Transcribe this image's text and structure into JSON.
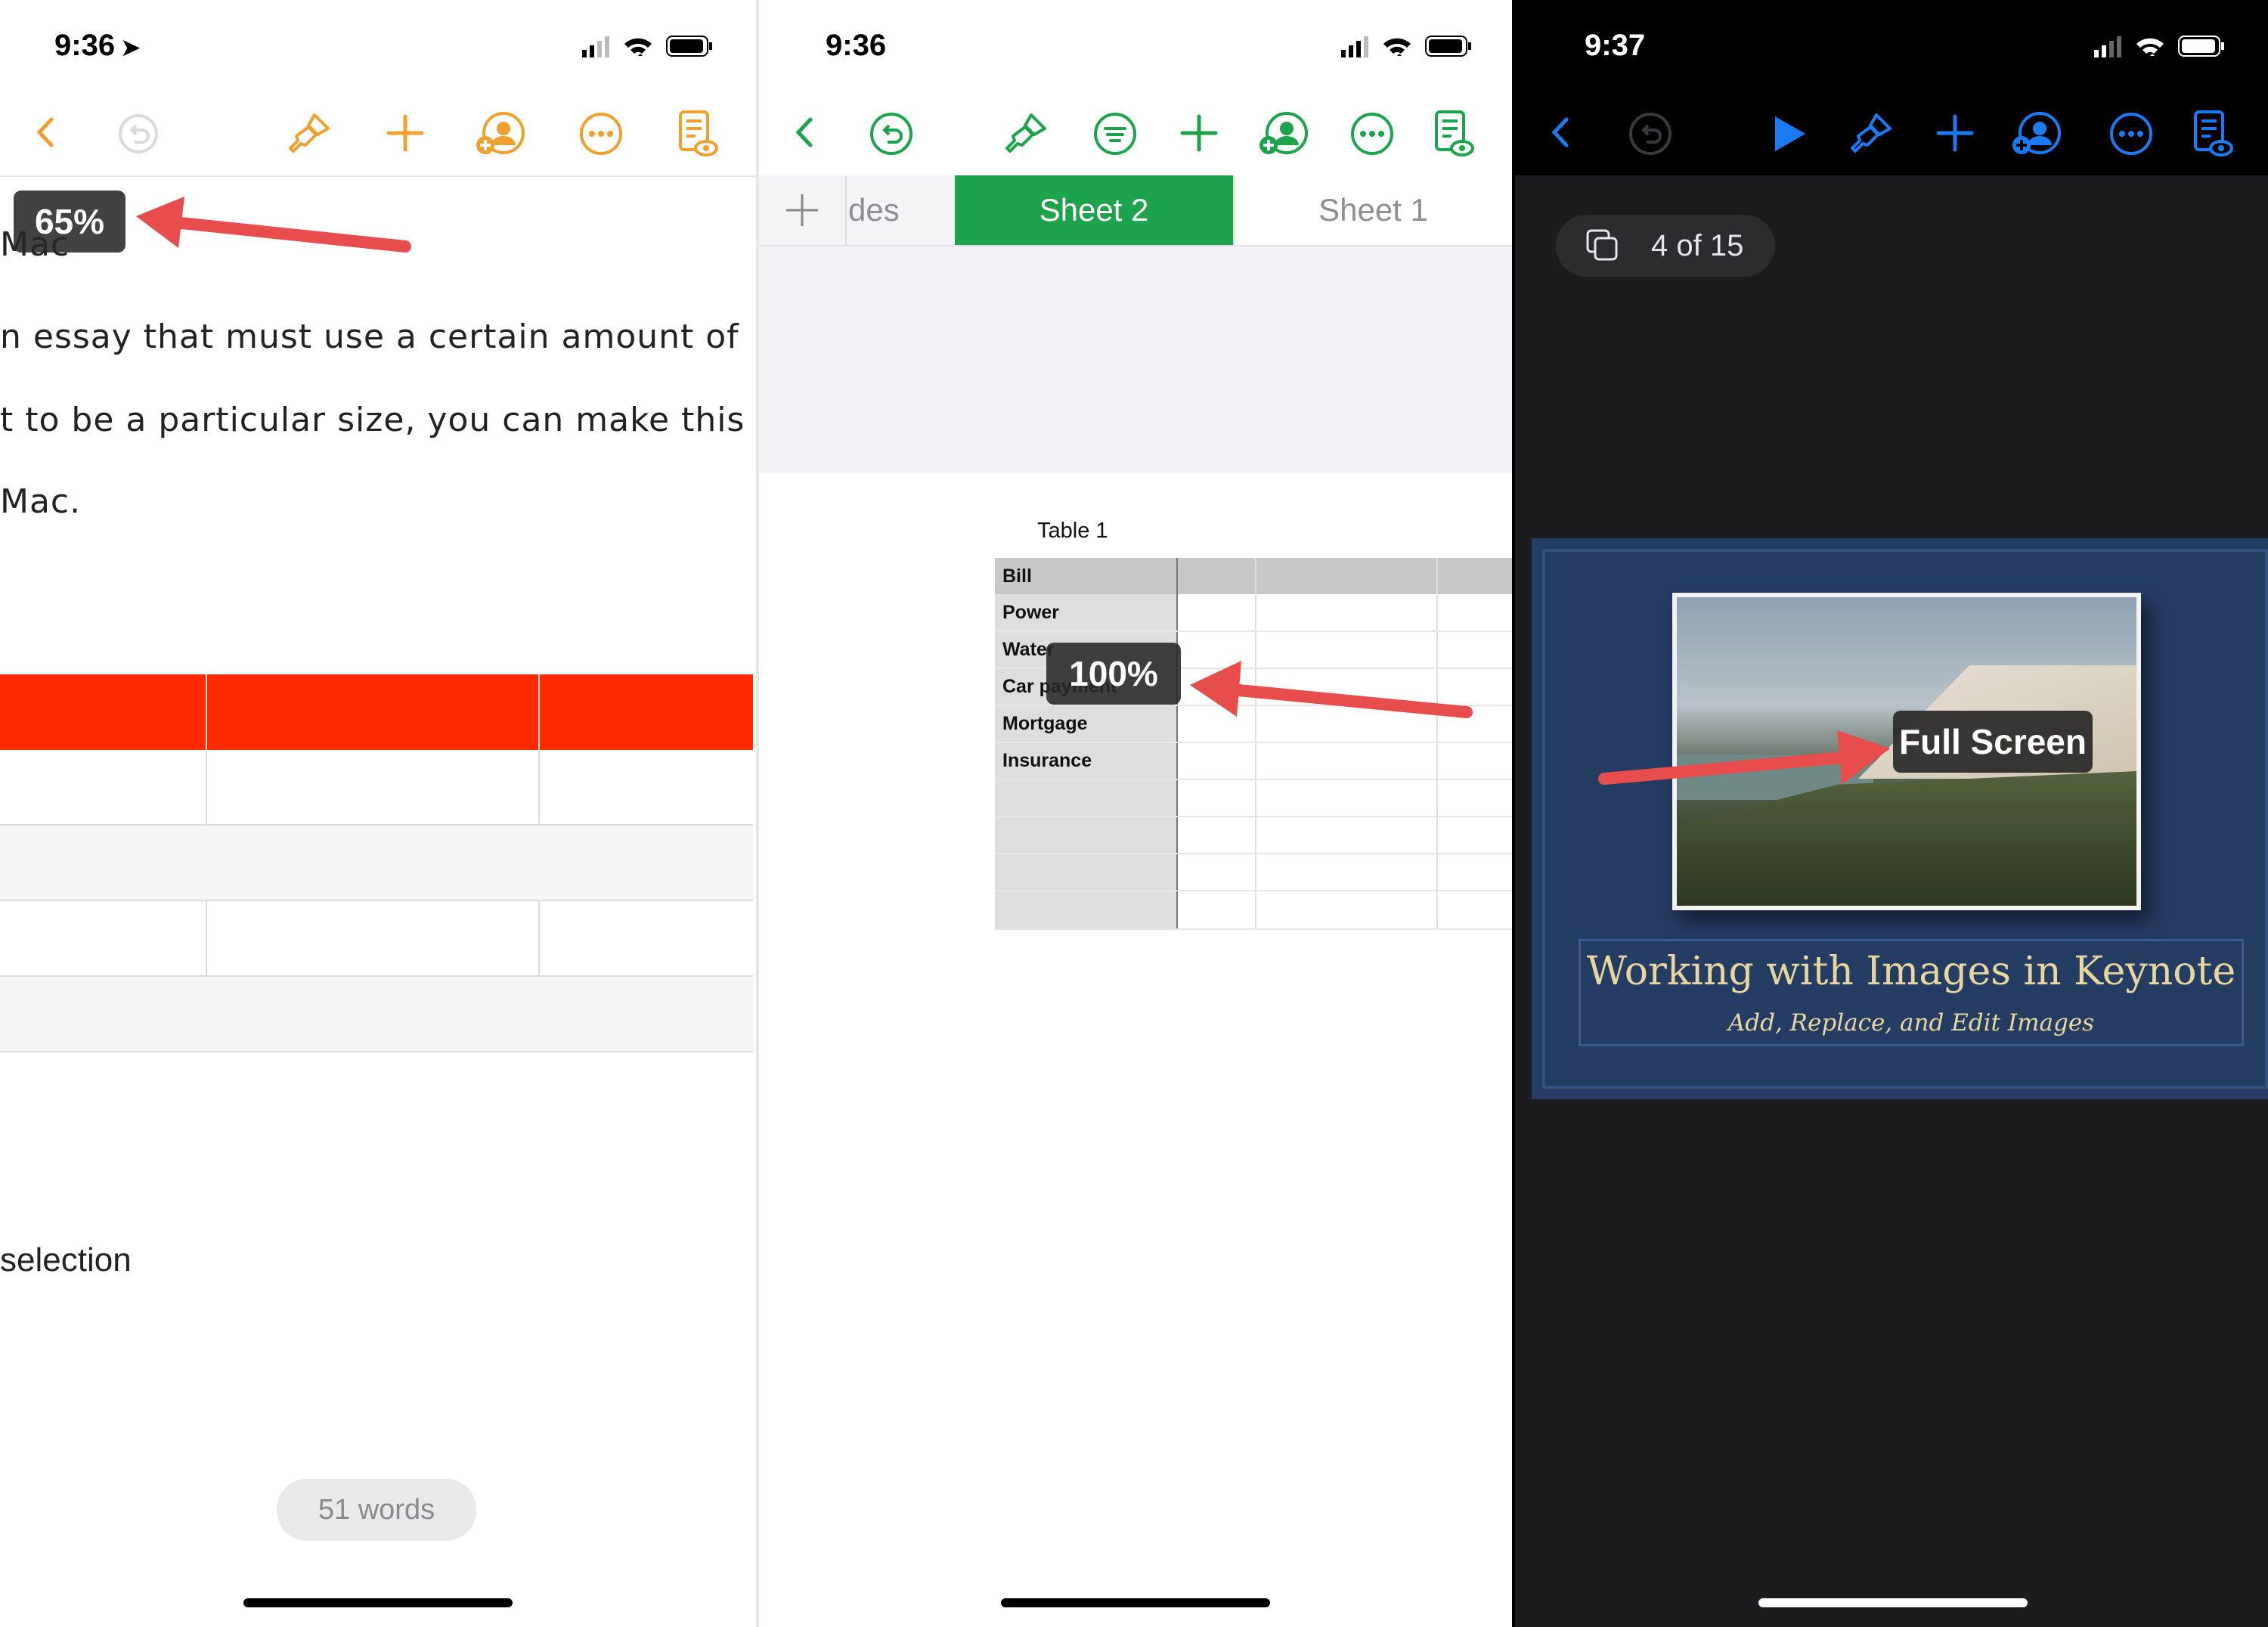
{
  "colors": {
    "pages_accent": "#f0a02e",
    "numbers_accent": "#1da34c",
    "keynote_accent": "#1b7bf5",
    "arrow": "#e84d4d",
    "red_header": "#ff2a00"
  },
  "pages": {
    "status_time": "9:36",
    "toolbar": {
      "back_icon": "chevron-left-icon",
      "undo_icon": "undo-icon",
      "format_icon": "paintbrush-icon",
      "insert_icon": "plus-icon",
      "collaborate_icon": "collaborate-icon",
      "more_icon": "more-icon",
      "view_icon": "view-options-icon"
    },
    "zoom_label": "65%",
    "text_lines": [
      "Mac",
      "n essay that must use a certain amount of",
      "t to be a particular size, you can make this",
      " Mac."
    ],
    "selection_text": "selection",
    "word_count": "51 words"
  },
  "numbers": {
    "status_time": "9:36",
    "toolbar": {
      "back_icon": "chevron-left-icon",
      "undo_icon": "undo-icon",
      "format_icon": "paintbrush-icon",
      "filter_icon": "filter-icon",
      "insert_icon": "plus-icon",
      "collaborate_icon": "collaborate-icon",
      "more_icon": "more-icon",
      "view_icon": "view-options-icon"
    },
    "tabs": [
      {
        "label": "des",
        "active": false
      },
      {
        "label": "Sheet 2",
        "active": true
      },
      {
        "label": "Sheet 1",
        "active": false
      }
    ],
    "table_title": "Table 1",
    "rows": [
      "Bill",
      "Power",
      "Water",
      "Car payment",
      "Mortgage",
      "Insurance"
    ],
    "zoom_label": "100%"
  },
  "keynote": {
    "status_time": "9:37",
    "toolbar": {
      "back_icon": "chevron-left-icon",
      "undo_icon": "undo-icon",
      "play_icon": "play-icon",
      "format_icon": "paintbrush-icon",
      "insert_icon": "plus-icon",
      "collaborate_icon": "collaborate-icon",
      "more_icon": "more-icon",
      "view_icon": "view-options-icon"
    },
    "slide_counter": "4 of 15",
    "slide_title": "Working with Images in Keynote",
    "slide_subtitle": "Add, Replace, and Edit Images",
    "tooltip": "Full Screen"
  }
}
